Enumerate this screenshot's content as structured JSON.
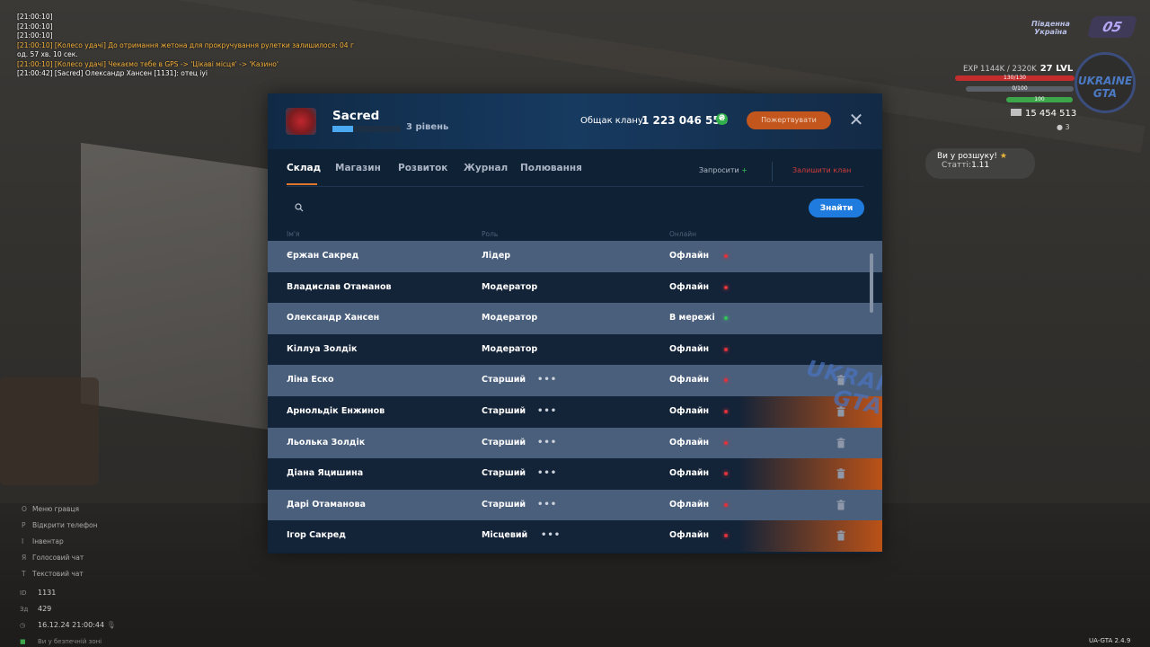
{
  "chat": [
    {
      "text": "[21:00:10]",
      "color": "white"
    },
    {
      "text": "[21:00:10]",
      "color": "white"
    },
    {
      "text": "[21:00:10]",
      "color": "white"
    },
    {
      "text": "[21:00:10] [Колесо удачі] До отримання жетона для прокручування рулетки залишилося: 04 г",
      "color": "orange"
    },
    {
      "text": "од. 57 хв. 10 сек.",
      "color": "white"
    },
    {
      "text": "[21:00:10] [Колесо удачі] Чекаємо тебе в GPS -> 'Цікаві місця' -> 'Казино'",
      "color": "orange"
    },
    {
      "text": "[21:00:42] [Sacred] Олександр Хансен [1131]: отец іуі",
      "color": "white"
    }
  ],
  "hud": {
    "region": "Південна\nУкраїна",
    "region_line1": "Південна",
    "region_line2": "Україна",
    "level_badge": "05",
    "exp": "EXP 1144K / 2320K",
    "lvl": "27 LVL",
    "health": "130/130",
    "armor": "0/100",
    "hunger": "100",
    "money": "15 454 513",
    "coins": "3",
    "logo_text": "UKRAINE GTA"
  },
  "wanted": {
    "title": "Ви у розшуку!",
    "stat_label": "Статті:",
    "stat_value": "1.11"
  },
  "menu": [
    {
      "key": "O",
      "label": "Меню гравця"
    },
    {
      "key": "P",
      "label": "Відкрити телефон"
    },
    {
      "key": "I",
      "label": "Інвентар"
    },
    {
      "key": "Я",
      "label": "Голосовий чат"
    },
    {
      "key": "T",
      "label": "Текстовий чат"
    }
  ],
  "player": {
    "id_label": "ID",
    "id": "1131",
    "online_label": "Зд",
    "online": "429",
    "datetime": "16.12.24 21:00:44",
    "safe_zone": "Ви у безпечній зоні"
  },
  "version": "UA-GTA 2.4.9",
  "clan": {
    "name": "Sacred",
    "level": "3 рівень",
    "level_progress": 0.3,
    "common_label": "Общак клану:",
    "common_value": "1 223 046 556",
    "currency_icon": "hryvna-icon",
    "donate_label": "Пожертвувати",
    "close_icon": "close-icon"
  },
  "tabs": [
    {
      "label": "Склад",
      "active": true
    },
    {
      "label": "Магазин"
    },
    {
      "label": "Розвиток"
    },
    {
      "label": "Журнал"
    },
    {
      "label": "Полювання"
    }
  ],
  "actions": {
    "invite": "Запросити",
    "invite_plus": "+",
    "leave": "Залишити клан"
  },
  "search": {
    "placeholder": "",
    "button": "Знайти"
  },
  "columns": {
    "name": "Ім'я",
    "role": "Роль",
    "online": "Онлайн"
  },
  "members": [
    {
      "name": "Єржан Сакред",
      "role": "Лідер",
      "status": "Офлайн",
      "online": false,
      "shade": "light",
      "menu": false,
      "delete": false
    },
    {
      "name": "Владислав Отаманов",
      "role": "Модератор",
      "status": "Офлайн",
      "online": false,
      "shade": "dark",
      "menu": false,
      "delete": false
    },
    {
      "name": "Олександр Хансен",
      "role": "Модератор",
      "status": "В мережі",
      "online": true,
      "shade": "light",
      "menu": false,
      "delete": false
    },
    {
      "name": "Кіллуа Золдік",
      "role": "Модератор",
      "status": "Офлайн",
      "online": false,
      "shade": "dark",
      "menu": false,
      "delete": false
    },
    {
      "name": "Ліна Еско",
      "role": "Старший",
      "status": "Офлайн",
      "online": false,
      "shade": "light",
      "menu": true,
      "delete": true
    },
    {
      "name": "Арнольдік Енжинов",
      "role": "Старший",
      "status": "Офлайн",
      "online": false,
      "shade": "dark",
      "menu": true,
      "delete": true,
      "glow": true
    },
    {
      "name": "Льолька Золдік",
      "role": "Старший",
      "status": "Офлайн",
      "online": false,
      "shade": "light",
      "menu": true,
      "delete": true
    },
    {
      "name": "Діана Яцишина",
      "role": "Старший",
      "status": "Офлайн",
      "online": false,
      "shade": "dark",
      "menu": true,
      "delete": true,
      "glow": true
    },
    {
      "name": "Дарі Отаманова",
      "role": "Старший",
      "status": "Офлайн",
      "online": false,
      "shade": "light",
      "menu": true,
      "delete": true
    },
    {
      "name": "Ігор Сакред",
      "role": "Місцевий",
      "status": "Офлайн",
      "online": false,
      "shade": "dark",
      "menu": true,
      "delete": true,
      "glow": true
    }
  ],
  "watermark": "UKRAINE GTA",
  "colors": {
    "online": "#36c25a",
    "offline": "#e0323c",
    "accent": "#e0752f",
    "primary": "#1f7cde"
  }
}
